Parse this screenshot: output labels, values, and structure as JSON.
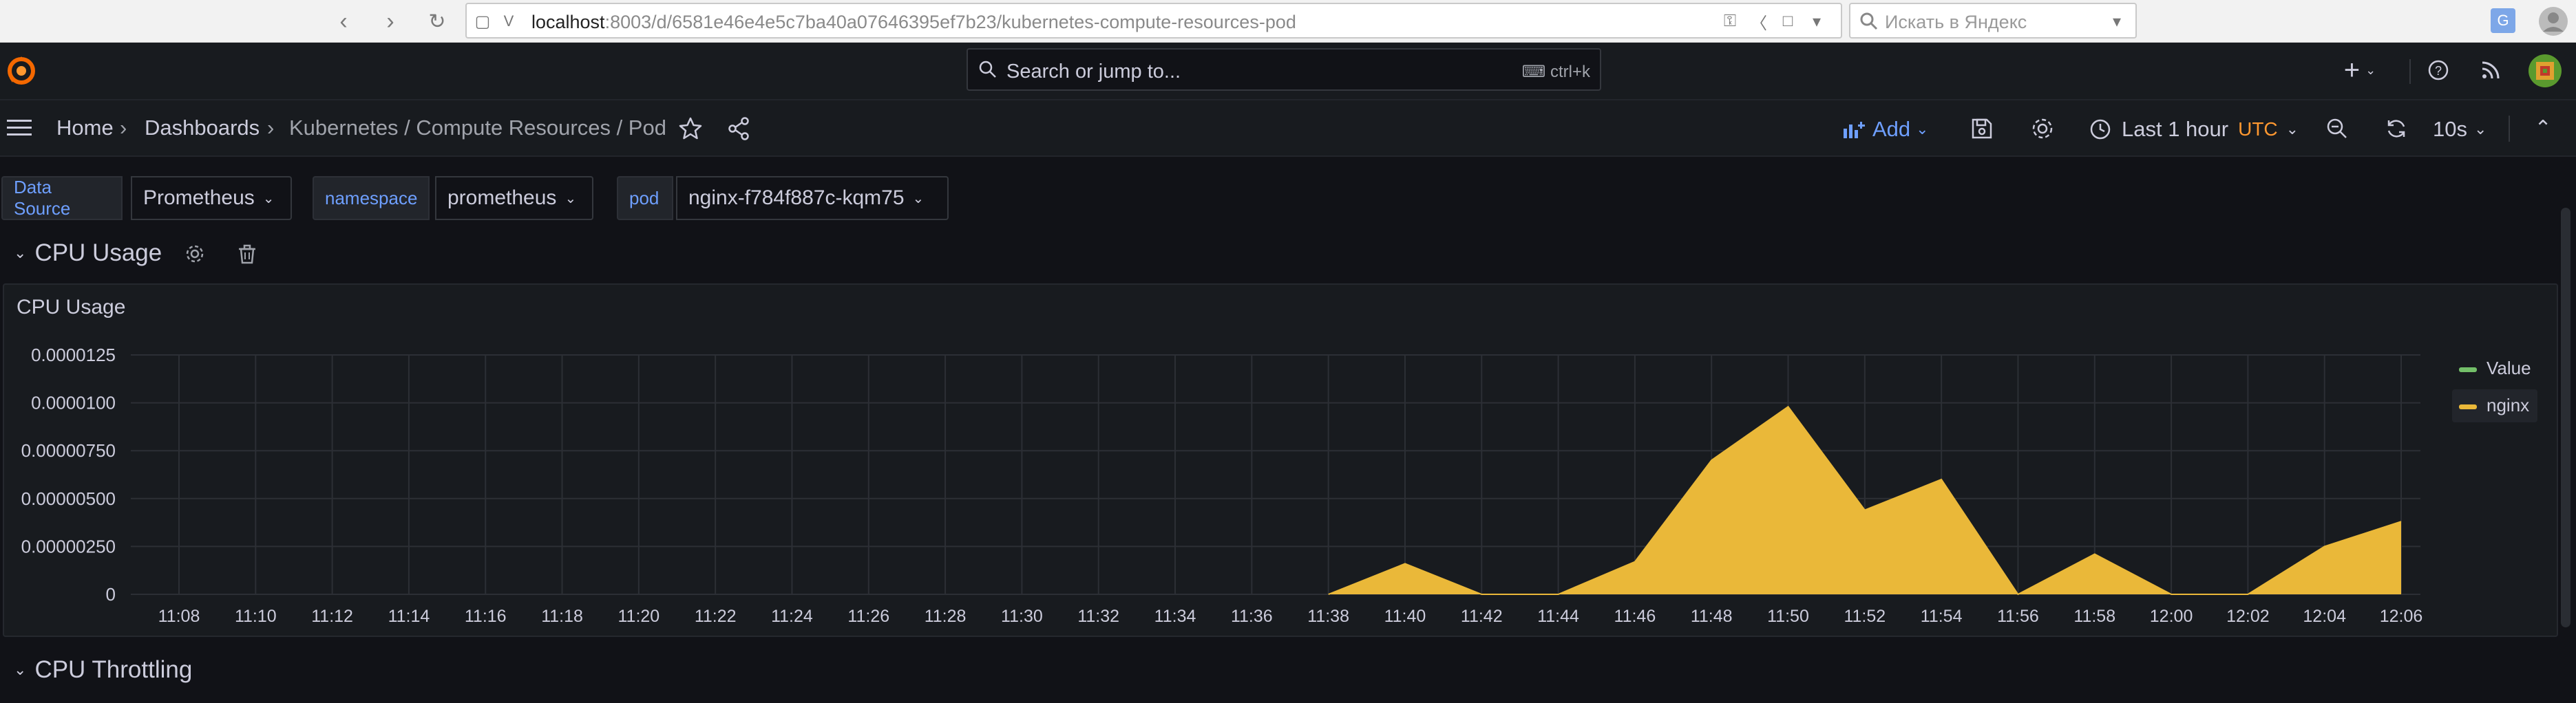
{
  "browser": {
    "url_host": "localhost",
    "url_rest": ":8003/d/6581e46e4e5c7ba40a07646395ef7b23/kubernetes-compute-resources-pod",
    "search_placeholder": "Искать в Яндекс"
  },
  "topbar": {
    "search_placeholder": "Search or jump to...",
    "search_shortcut": "ctrl+k"
  },
  "dashbar": {
    "breadcrumb": [
      "Home",
      "Dashboards",
      "Kubernetes / Compute Resources / Pod"
    ],
    "add_label": "Add",
    "time_range": "Last 1 hour",
    "timezone": "UTC",
    "refresh_interval": "10s"
  },
  "variables": [
    {
      "label": "Data Source",
      "value": "Prometheus"
    },
    {
      "label": "namespace",
      "value": "prometheus"
    },
    {
      "label": "pod",
      "value": "nginx-f784f887c-kqm75"
    }
  ],
  "rows": {
    "cpu_usage": "CPU Usage",
    "cpu_throttling": "CPU Throttling"
  },
  "panel": {
    "title": "CPU Usage"
  },
  "colors": {
    "accent": "#6e9fff",
    "timezone": "#ff9830",
    "value_series": "#73bf69",
    "nginx_series": "#eab839"
  },
  "chart_data": {
    "type": "area",
    "title": "CPU Usage",
    "x_tick_labels": [
      "11:08",
      "11:10",
      "11:12",
      "11:14",
      "11:16",
      "11:18",
      "11:20",
      "11:22",
      "11:24",
      "11:26",
      "11:28",
      "11:30",
      "11:32",
      "11:34",
      "11:36",
      "11:38",
      "11:40",
      "11:42",
      "11:44",
      "11:46",
      "11:48",
      "11:50",
      "11:52",
      "11:54",
      "11:56",
      "11:58",
      "12:00",
      "12:02",
      "12:04",
      "12:06"
    ],
    "y_tick_labels": [
      "0",
      "0.00000250",
      "0.00000500",
      "0.00000750",
      "0.0000100",
      "0.0000125"
    ],
    "ylim": [
      0,
      1.25e-05
    ],
    "grid": true,
    "legend_position": "right",
    "series": [
      {
        "name": "Value",
        "color": "#73bf69",
        "x": [],
        "y": []
      },
      {
        "name": "nginx",
        "color": "#eab839",
        "x": [
          "11:38",
          "11:40",
          "11:42",
          "11:44",
          "11:46",
          "11:48",
          "11:50",
          "11:52",
          "11:54",
          "11:56",
          "11:58",
          "12:00",
          "12:02",
          "12:04",
          "12:06"
        ],
        "y": [
          0,
          1.6e-06,
          0,
          0,
          1.7e-06,
          7e-06,
          9.8e-06,
          4.4e-06,
          6e-06,
          0,
          2.1e-06,
          0,
          0,
          2.5e-06,
          3.8e-06
        ]
      }
    ]
  }
}
